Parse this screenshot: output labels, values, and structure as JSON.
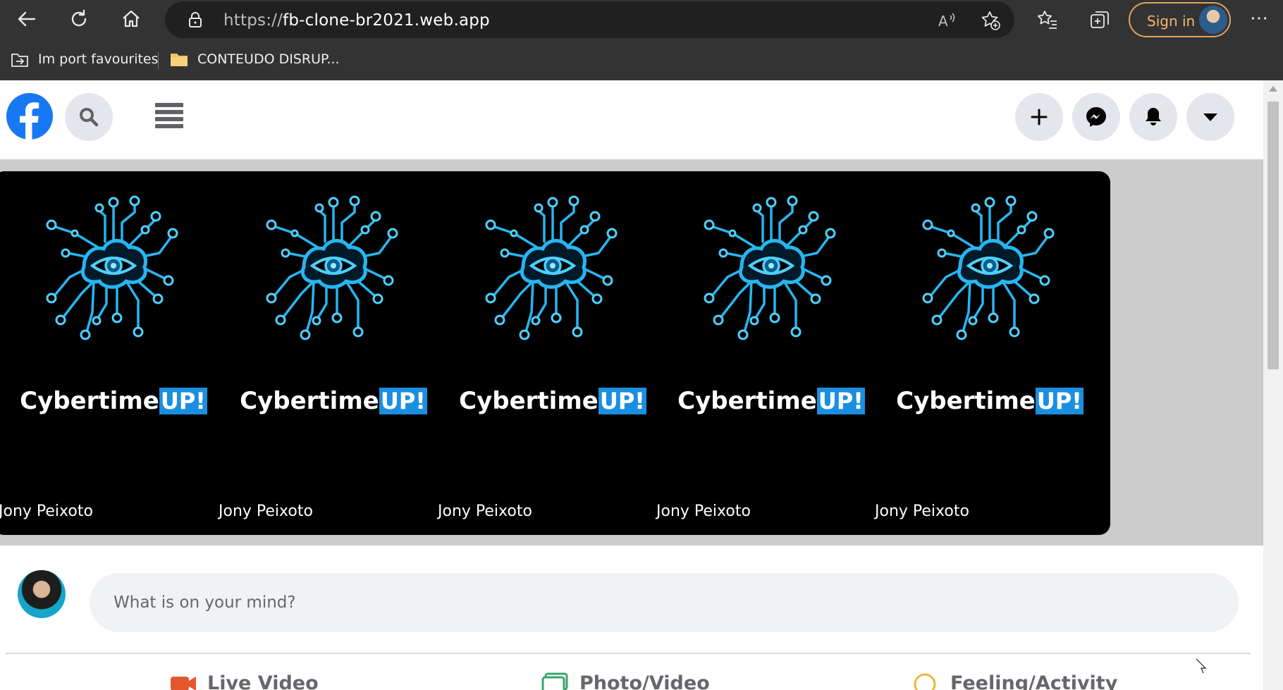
{
  "browser": {
    "url_protocol": "https://",
    "url_host": "fb-clone-br2021.web.app",
    "signin_label": "Sign in",
    "more_label": "⋯",
    "favourites": [
      {
        "label": "Im port favourites",
        "icon": "import-icon"
      },
      {
        "label": "CONTEUDO DISRUP...",
        "icon": "folder-icon"
      }
    ],
    "accent_color": "#e2a262"
  },
  "page": {
    "brand_color": "#1877f2",
    "stories": [
      {
        "brand_main": "Cybertime",
        "brand_badge": "UP!",
        "author": "Jony Peixoto"
      },
      {
        "brand_main": "Cybertime",
        "brand_badge": "UP!",
        "author": "Jony Peixoto"
      },
      {
        "brand_main": "Cybertime",
        "brand_badge": "UP!",
        "author": "Jony Peixoto"
      },
      {
        "brand_main": "Cybertime",
        "brand_badge": "UP!",
        "author": "Jony Peixoto"
      },
      {
        "brand_main": "Cybertime",
        "brand_badge": "UP!",
        "author": "Jony Peixoto"
      }
    ],
    "composer": {
      "placeholder": "What is on your mind?",
      "actions": [
        {
          "label": "Live Video",
          "icon": "video-camera-icon",
          "color": "#e4572e"
        },
        {
          "label": "Photo/Video",
          "icon": "photo-icon",
          "color": "#3aa56b"
        },
        {
          "label": "Feeling/Activity",
          "icon": "smiley-icon",
          "color": "#f0b73b"
        }
      ]
    }
  }
}
